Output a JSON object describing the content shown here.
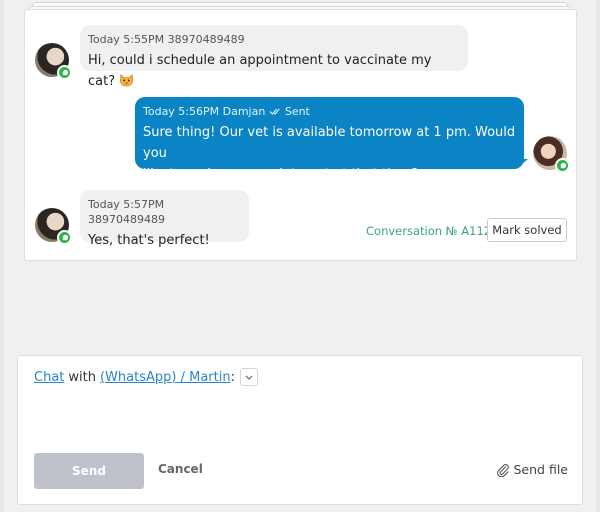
{
  "thread": {
    "messages": [
      {
        "direction": "in",
        "meta": "Today 5:55PM 38970489489",
        "text": "Hi, could i schedule an appointment to vaccinate my cat?",
        "emoji": "cat-face-icon"
      },
      {
        "direction": "out",
        "meta": "Today 5:56PM Damjan",
        "status": "Sent",
        "text_line1": "Sure thing! Our vet is available tomorrow at 1 pm. Would you",
        "text_line2": "like to make an appointment at that time?"
      },
      {
        "direction": "in",
        "meta": "Today 5:57PM 38970489489",
        "text": "Yes, that's perfect!"
      }
    ],
    "conversation_id": "Conversation № A112",
    "mark_solved_label": "Mark solved"
  },
  "composer": {
    "chat_link": "Chat",
    "with_text": "with",
    "contact_link": "(WhatsApp) / Martin",
    "colon": ":",
    "send_label": "Send",
    "cancel_label": "Cancel",
    "send_file_label": "Send file"
  },
  "colors": {
    "outgoing_bubble": "#0a84c4",
    "incoming_bubble": "#f0eff1",
    "whatsapp_badge": "#2fb34a",
    "conversation_id": "#3aa57a",
    "link": "#2a84c7"
  }
}
